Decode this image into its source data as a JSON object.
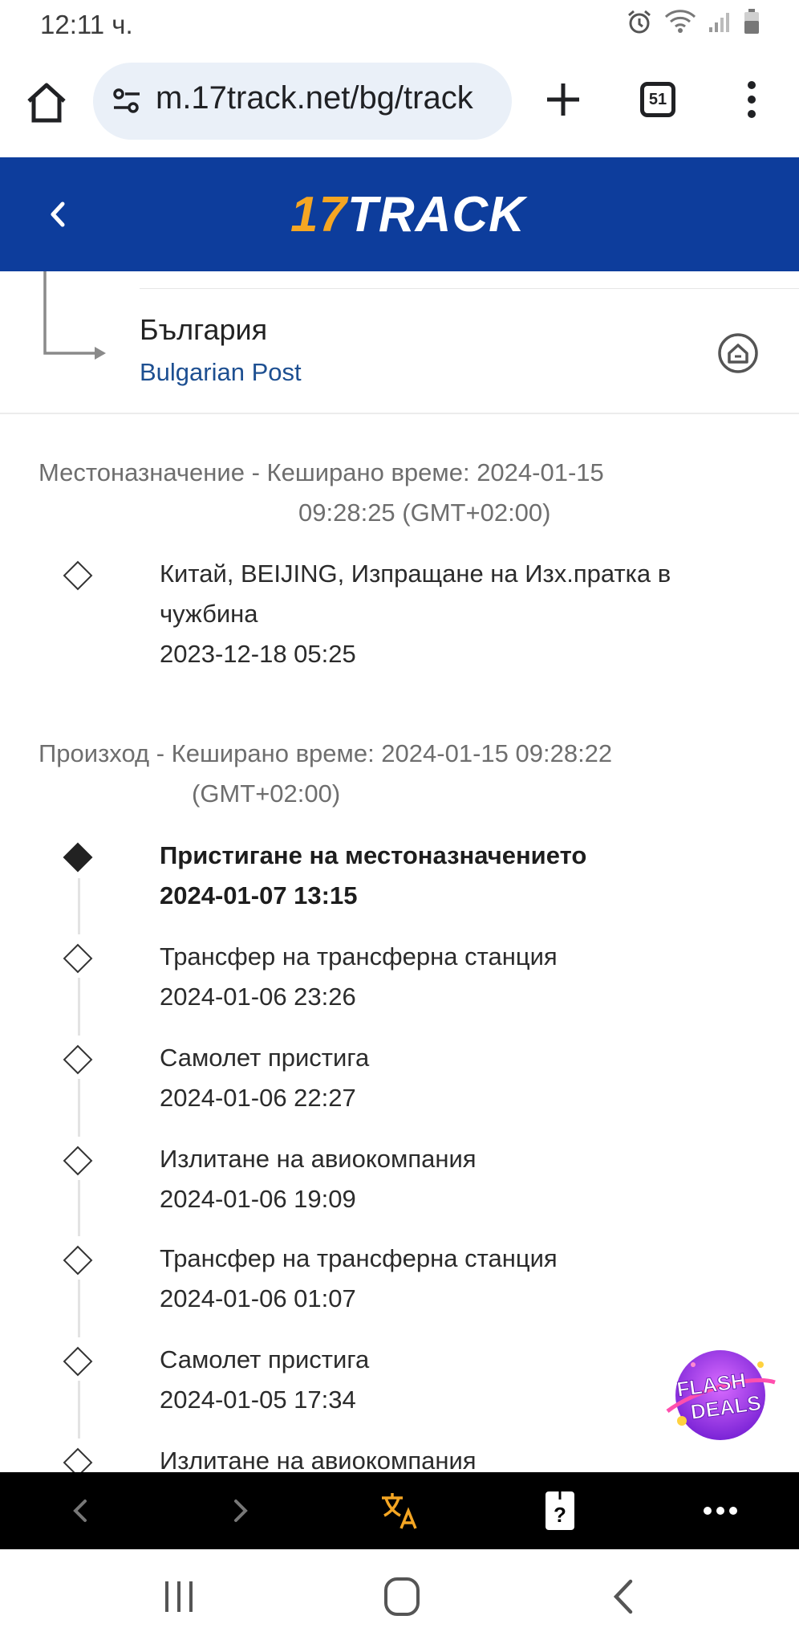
{
  "status_bar": {
    "time": "12:11 ч."
  },
  "browser": {
    "url": "m.17track.net/bg/track",
    "tab_count": "51"
  },
  "app_header": {
    "logo_number": "17",
    "logo_text": "TRACK"
  },
  "destination": {
    "country": "България",
    "carrier": "Bulgarian Post"
  },
  "sections": [
    {
      "heading_line1": "Местоназначение - Кеширано време: 2024-01-15",
      "heading_line2": "09:28:25 (GMT+02:00)",
      "events": [
        {
          "desc_line1": "Китай, BEIJING, Изпращане на Изх.пратка в",
          "desc_line2": "чужбина",
          "time": "2023-12-18 05:25"
        }
      ]
    },
    {
      "heading_line1": "Произход - Кеширано време: 2024-01-15 09:28:22",
      "heading_line2": "(GMT+02:00)",
      "events": [
        {
          "desc": "Пристигане на местоназначението",
          "time": "2024-01-07 13:15",
          "latest": true
        },
        {
          "desc": "Трансфер на трансферна станция",
          "time": "2024-01-06 23:26"
        },
        {
          "desc": "Самолет пристига",
          "time": "2024-01-06 22:27"
        },
        {
          "desc": "Излитане на авиокомпания",
          "time": "2024-01-06 19:09"
        },
        {
          "desc": "Трансфер на трансферна станция",
          "time": "2024-01-06 01:07"
        },
        {
          "desc": "Самолет пристига",
          "time": "2024-01-05 17:34"
        },
        {
          "desc": "Излитане на авиокомпания"
        }
      ]
    }
  ],
  "promo": {
    "line1": "FLASH",
    "line2": "DEALS"
  },
  "toolbar": {
    "items": [
      "back-icon",
      "forward-icon",
      "translate-icon",
      "help-icon",
      "more-icon"
    ],
    "accent": "#f5a623"
  },
  "colors": {
    "header_bg": "#0d3d9c",
    "logo_accent": "#f5a623",
    "carrier_link": "#1d4f91"
  }
}
